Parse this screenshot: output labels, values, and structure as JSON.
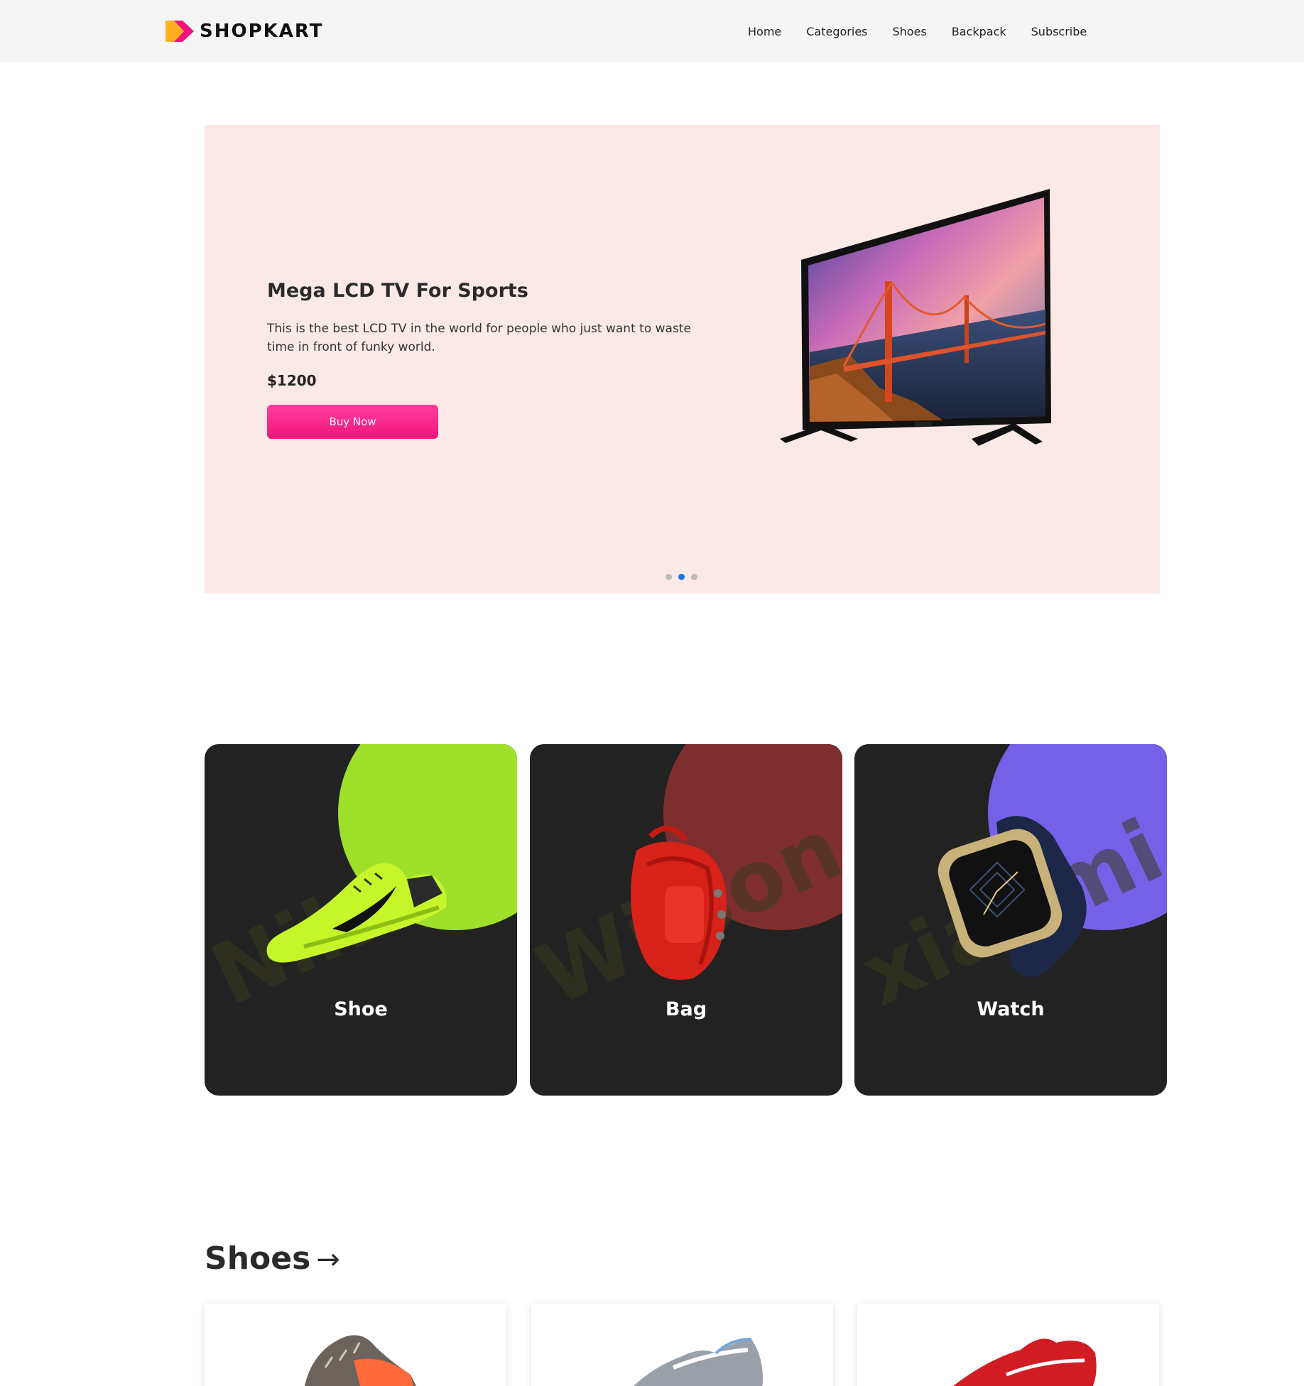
{
  "header": {
    "brand": "SHOPKART",
    "nav": [
      "Home",
      "Categories",
      "Shoes",
      "Backpack",
      "Subscribe"
    ]
  },
  "hero": {
    "title": "Mega LCD TV For Sports",
    "description": "This is the best LCD TV in the world for people who just want to waste time in front of funky world.",
    "price": "$1200",
    "button": "Buy Now",
    "active_slide": 2,
    "slide_count": 3,
    "background": "#fbe9e7"
  },
  "categories": [
    {
      "label": "Shoe",
      "watermark": "Nike",
      "accent": "#9ee02a"
    },
    {
      "label": "Bag",
      "watermark": "Wilson",
      "accent": "#7f2e2e"
    },
    {
      "label": "Watch",
      "watermark": "xiaomi",
      "accent": "#7560e8"
    }
  ],
  "shoes_section": {
    "title": "Shoes",
    "arrow": "→"
  },
  "colors": {
    "accent_pink": "#f0157a",
    "active_dot": "#1e73e8",
    "card_bg": "#222222"
  },
  "icons": [
    "logo-play-icon",
    "arrow-right-icon"
  ]
}
